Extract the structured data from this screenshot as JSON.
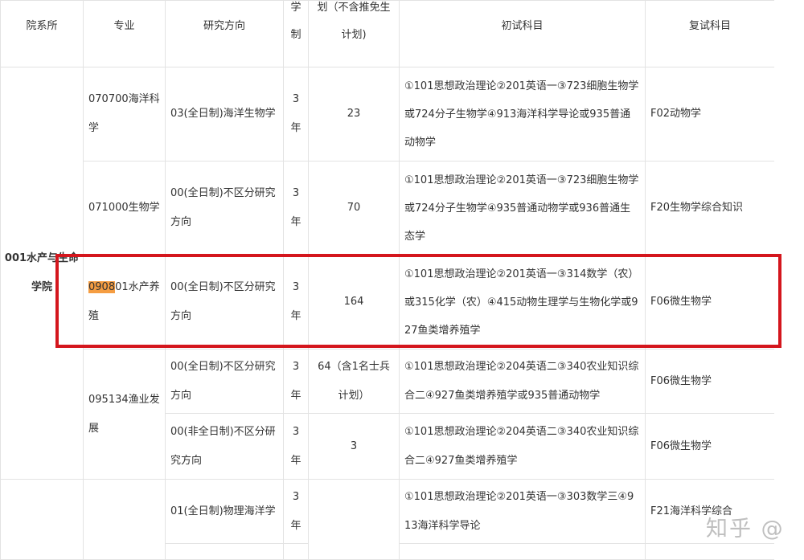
{
  "header": {
    "dept": "院系所",
    "major": "专业",
    "direction": "研究方向",
    "duration": [
      "学",
      "制"
    ],
    "plan": [
      "划（不含推免生",
      "计划)"
    ],
    "first_exam": "初试科目",
    "second_exam": "复试科目"
  },
  "dept_name": [
    "001水产与生命",
    "学院"
  ],
  "rows": [
    {
      "major": "070700海洋科学",
      "direction": "03(全日制)海洋生物学",
      "duration": [
        "3",
        "年"
      ],
      "plan": "23",
      "exam": "①101思想政治理论②201英语一③723细胞生物学或724分子生物学④913海洋科学导论或935普通动物学",
      "retest": "F02动物学"
    },
    {
      "major": "071000生物学",
      "direction": "00(全日制)不区分研究方向",
      "duration": [
        "3",
        "年"
      ],
      "plan": "70",
      "exam": "①101思想政治理论②201英语一③723细胞生物学或724分子生物学④935普通动物学或936普通生态学",
      "retest": "F20生物学综合知识"
    },
    {
      "major_highlight": "0908",
      "major_rest": "01水产养殖",
      "direction": "00(全日制)不区分研究方向",
      "duration": [
        "3",
        "年"
      ],
      "plan": "164",
      "exam": "①101思想政治理论②201英语一③314数学（农）或315化学（农）④415动物生理学与生物化学或927鱼类增养殖学",
      "retest": "F06微生物学"
    },
    {
      "major": "095134渔业发展",
      "direction": "00(全日制)不区分研究方向",
      "duration": [
        "3",
        "年"
      ],
      "plan": "64（含1名士兵计划）",
      "exam": "①101思想政治理论②204英语二③340农业知识综合二④927鱼类增养殖学或935普通动物学",
      "retest": "F06微生物学"
    },
    {
      "direction": "00(非全日制)不区分研究方向",
      "duration": [
        "3",
        "年"
      ],
      "plan": "3",
      "exam": "①101思想政治理论②204英语二③340农业知识综合二④927鱼类增养殖学",
      "retest": "F06微生物学"
    },
    {
      "direction": "01(全日制)物理海洋学",
      "duration": [
        "3",
        "年"
      ],
      "plan": "",
      "exam": "①101思想政治理论②201英语一③303数学三④913海洋科学导论",
      "retest": "F21海洋科学综合"
    }
  ],
  "watermark": "知乎 @",
  "colors": {
    "highlight": "#f59d42",
    "red_box": "#d4161d",
    "border": "#e3e3e3"
  }
}
